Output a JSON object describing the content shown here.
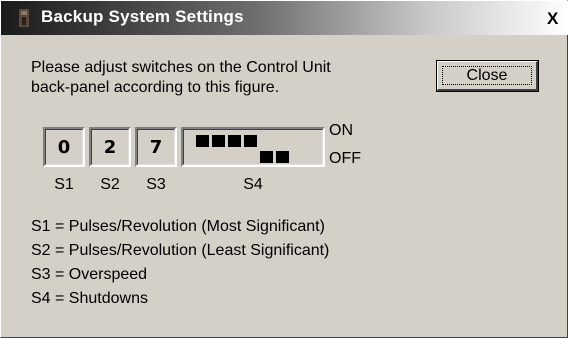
{
  "window": {
    "title": "Backup System Settings",
    "close_glyph": "X",
    "icon": "app-icon"
  },
  "instructions": {
    "line1": "Please adjust switches on the Control Unit",
    "line2": "back-panel according to this figure."
  },
  "close_button": {
    "label": "Close"
  },
  "switches": {
    "s1": {
      "label": "S1",
      "value": "0"
    },
    "s2": {
      "label": "S2",
      "value": "2"
    },
    "s3": {
      "label": "S3",
      "value": "7"
    },
    "s4": {
      "label": "S4",
      "positions": [
        "ON",
        "ON",
        "ON",
        "ON",
        "OFF",
        "OFF"
      ]
    },
    "on_label": "ON",
    "off_label": "OFF"
  },
  "legend": [
    "S1 = Pulses/Revolution (Most Significant)",
    "S2 = Pulses/Revolution (Least Significant)",
    "S3 = Overspeed",
    "S4 = Shutdowns"
  ]
}
